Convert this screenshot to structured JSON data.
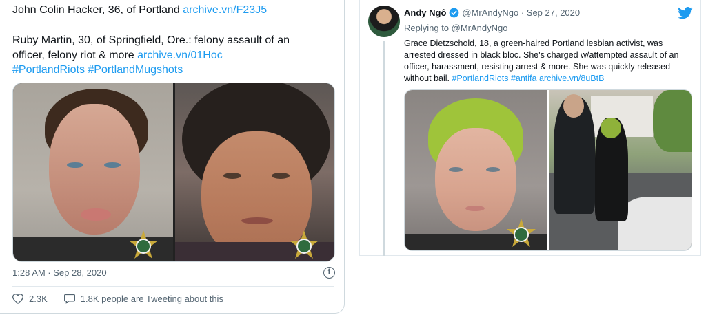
{
  "left_tweet": {
    "line1_text": "John Colin Hacker, 36, of Portland ",
    "line1_link": "archive.vn/F23J5",
    "line2_text": "Ruby Martin, 30, of Springfield, Ore.: felony assault of an",
    "line3_text": "officer, felony riot & more ",
    "line3_link": "archive.vn/01Hoc",
    "hashtags": "#PortlandRiots #PortlandMugshots",
    "timestamp": "1:28 AM · Sep 28, 2020",
    "likes": "2.3K",
    "conversation": "1.8K people are Tweeting about this",
    "info_glyph": "i"
  },
  "right_tweet": {
    "author_name": "Andy Ngô",
    "handle_date": "@MrAndyNgo · Sep 27, 2020",
    "replying_to": "Replying to @MrAndyNgo",
    "body_text": "Grace Dietzschold, 18, a green-haired Portland lesbian activist, was arrested dressed in black bloc. She's charged w/attempted assault of an officer, harassment, resisting arrest & more. She was quickly released without bail. ",
    "body_links": "#PortlandRiots #antifa archive.vn/8uBtB"
  },
  "icons": {
    "verified": "verified-badge-icon",
    "twitter": "twitter-bird-icon",
    "info": "info-icon",
    "like": "heart-icon",
    "reply": "speech-bubble-icon"
  },
  "colors": {
    "link": "#1d9bf0",
    "muted": "#536471",
    "border": "#cfd9de"
  }
}
